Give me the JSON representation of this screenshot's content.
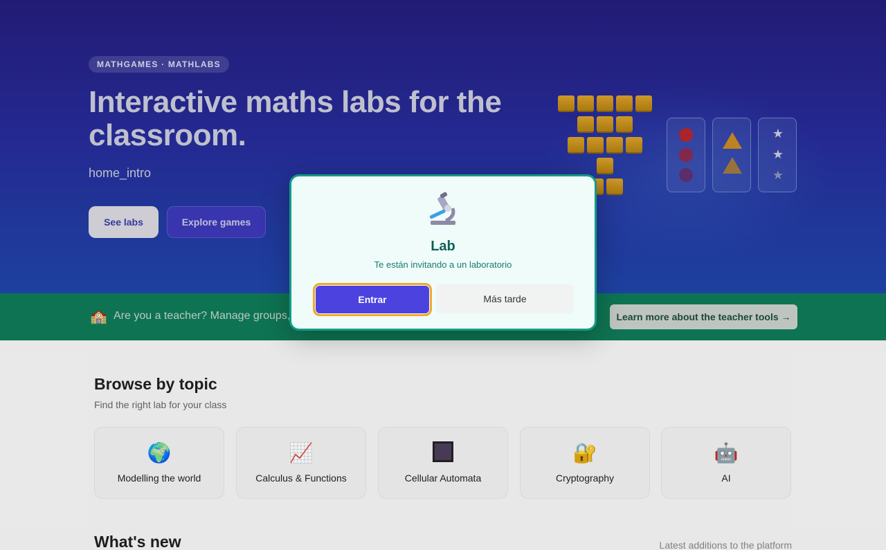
{
  "hero": {
    "badge": "MATHGAMES · MATHLABS",
    "title": "Interactive maths labs for the classroom.",
    "intro": "home_intro",
    "see_labs_label": "See labs",
    "explore_games_label": "Explore games"
  },
  "teacher_banner": {
    "icon": "school-icon",
    "text": "Are you a teacher? Manage groups,",
    "cta_label": "Learn more about the teacher tools →"
  },
  "browse": {
    "title": "Browse by topic",
    "subtitle": "Find the right lab for your class",
    "topics": [
      {
        "label": "Modelling the world",
        "icon": "globe-icon"
      },
      {
        "label": "Calculus & Functions",
        "icon": "chart-increasing-icon"
      },
      {
        "label": "Cellular Automata",
        "icon": "grid-square-icon"
      },
      {
        "label": "Cryptography",
        "icon": "lock-icon"
      },
      {
        "label": "AI",
        "icon": "robot-icon"
      }
    ]
  },
  "whats_new": {
    "title": "What's new",
    "subtitle": "Latest additions to the platform"
  },
  "modal": {
    "icon": "microscope-icon",
    "title": "Lab",
    "message": "Te están invitando a un laboratorio",
    "enter_label": "Entrar",
    "later_label": "Más tarde"
  },
  "colors": {
    "hero_bg": "#262b98",
    "teacher_bg": "#0f7a57",
    "modal_border": "#139a85",
    "primary_button": "#4b42e0",
    "focus_ring": "#f0a928"
  }
}
